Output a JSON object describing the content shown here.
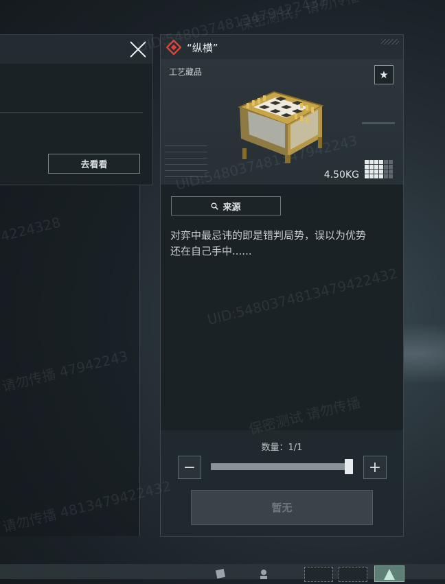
{
  "left_dialog": {
    "go_button": "去看看"
  },
  "item": {
    "title": "“纵横”",
    "category": "工艺藏品",
    "weight": "4.50KG",
    "source_button": "来源",
    "description_line1": "对弈中最忌讳的即是错判局势，误以为优势",
    "description_line2": "还在自己手中......",
    "quantity_label": "数量：1/1",
    "quantity_value": 1,
    "quantity_max": 1,
    "confirm_button": "暂无",
    "size_grid": {
      "cols": 6,
      "rows": 4,
      "filled_cols": 4
    }
  },
  "colors": {
    "accent_red": "#d9433a",
    "panel_bg": "#1b2226",
    "active_slot": "#5e7f76"
  },
  "icons": {
    "close": "close-icon",
    "favorite": "star-icon",
    "source": "search-icon",
    "rarity": "diamond-icon"
  },
  "watermarks": [
    "保密测试，请勿传播",
    "UID:5480374813479422432",
    "4224328",
    "UID:548037481347942243",
    "UID:5480374813479422432",
    "请勿传播 47942243",
    "保密测试 请勿传播",
    "请勿传播 4813479422432"
  ]
}
